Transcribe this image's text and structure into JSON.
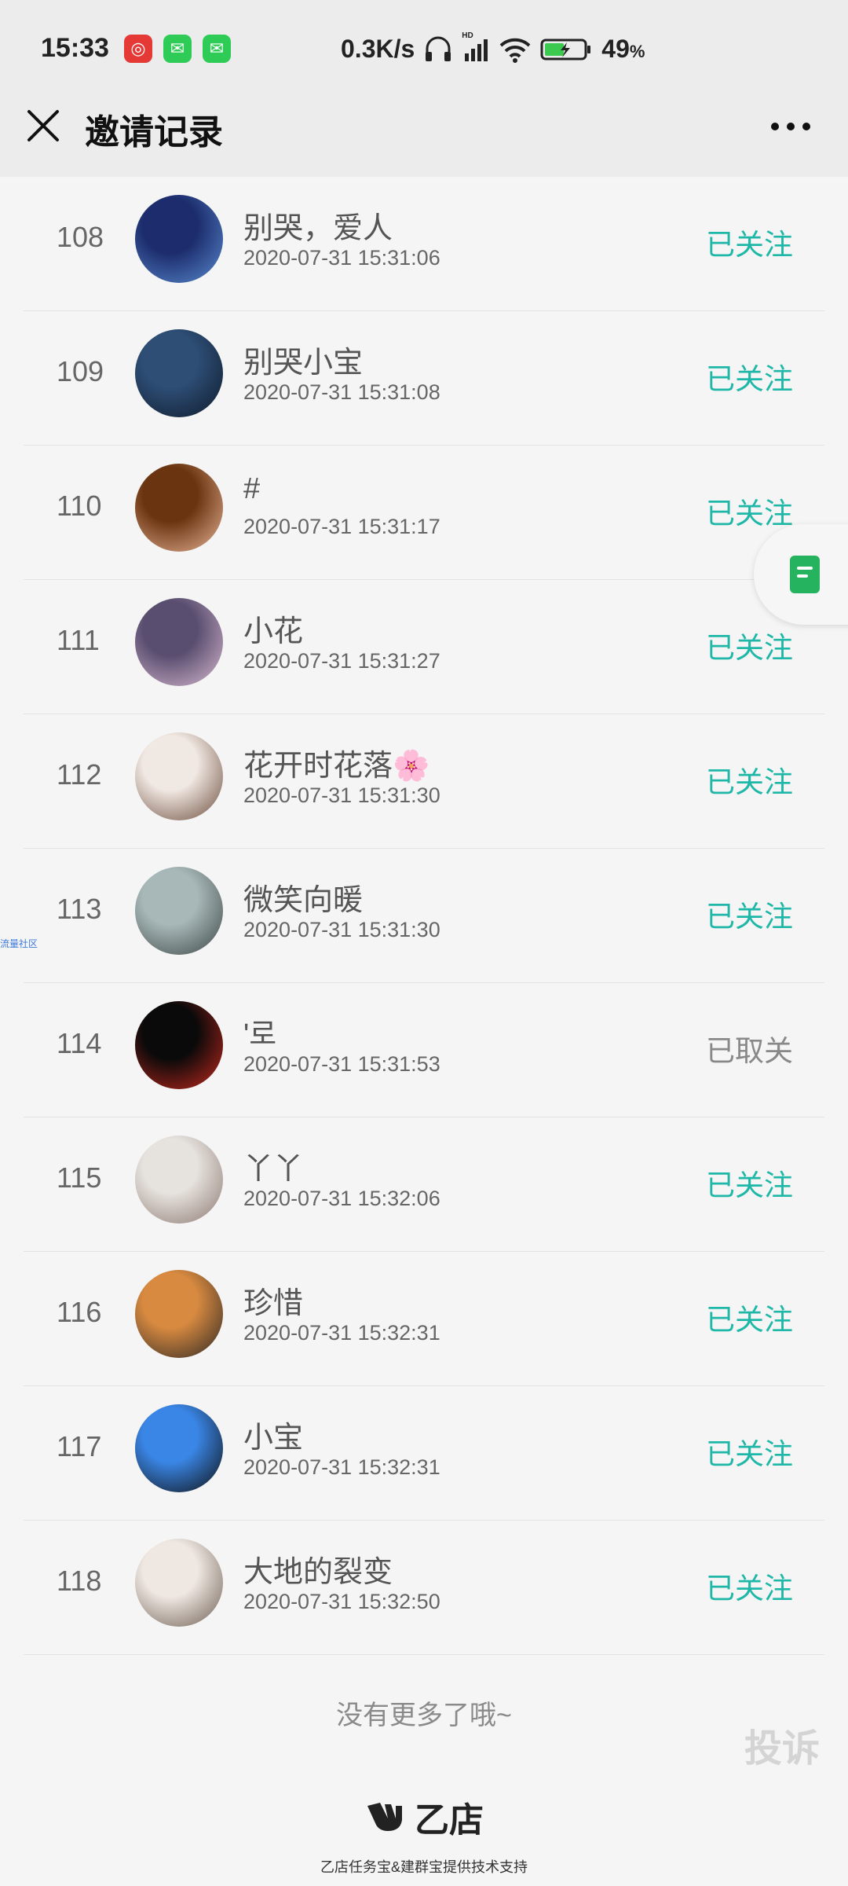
{
  "status_bar": {
    "time": "15:33",
    "network_speed": "0.3K/s",
    "battery": "49",
    "battery_unit": "%",
    "hd_label": "HD"
  },
  "nav": {
    "title": "邀请记录"
  },
  "rows": [
    {
      "index": "108",
      "name": "别哭，爱人",
      "time": "2020-07-31 15:31:06",
      "status": "已关注",
      "status_kind": "followed",
      "avatar_colors": [
        "#1c2c6c",
        "#5a8cd0"
      ]
    },
    {
      "index": "109",
      "name": "别哭小宝",
      "time": "2020-07-31 15:31:08",
      "status": "已关注",
      "status_kind": "followed",
      "avatar_colors": [
        "#2e4e76",
        "#0e1a2a"
      ]
    },
    {
      "index": "110",
      "name": "#",
      "time": "2020-07-31 15:31:17",
      "status": "已关注",
      "status_kind": "followed",
      "avatar_colors": [
        "#6b3410",
        "#e9b79a"
      ]
    },
    {
      "index": "111",
      "name": "小花",
      "time": "2020-07-31 15:31:27",
      "status": "已关注",
      "status_kind": "followed",
      "avatar_colors": [
        "#5a4e70",
        "#d9bad0"
      ]
    },
    {
      "index": "112",
      "name": "花开时花落🌸",
      "time": "2020-07-31 15:31:30",
      "status": "已关注",
      "status_kind": "followed",
      "avatar_colors": [
        "#f0e8e2",
        "#6b4a3a"
      ]
    },
    {
      "index": "113",
      "name": "微笑向暖",
      "time": "2020-07-31 15:31:30",
      "status": "已关注",
      "status_kind": "followed",
      "avatar_colors": [
        "#a8b8b8",
        "#3c4646"
      ]
    },
    {
      "index": "114",
      "name": "'로",
      "time": "2020-07-31 15:31:53",
      "status": "已取关",
      "status_kind": "unfollowed",
      "avatar_colors": [
        "#0a0a0a",
        "#c8281e"
      ]
    },
    {
      "index": "115",
      "name": "丫丫",
      "time": "2020-07-31 15:32:06",
      "status": "已关注",
      "status_kind": "followed",
      "avatar_colors": [
        "#e6e2de",
        "#8c7870"
      ]
    },
    {
      "index": "116",
      "name": "珍惜",
      "time": "2020-07-31 15:32:31",
      "status": "已关注",
      "status_kind": "followed",
      "avatar_colors": [
        "#d88a40",
        "#2a2624"
      ]
    },
    {
      "index": "117",
      "name": "小宝",
      "time": "2020-07-31 15:32:31",
      "status": "已关注",
      "status_kind": "followed",
      "avatar_colors": [
        "#3a86e6",
        "#0e0e0e"
      ]
    },
    {
      "index": "118",
      "name": "大地的裂变",
      "time": "2020-07-31 15:32:50",
      "status": "已关注",
      "status_kind": "followed",
      "avatar_colors": [
        "#efe8e2",
        "#6c5c50"
      ]
    }
  ],
  "footer": {
    "no_more": "没有更多了哦~",
    "complain": "投诉",
    "brand_name": "乙店",
    "brand_sub": "乙店任务宝&建群宝提供技术支持"
  },
  "side_watermark": "流量社区",
  "colors": {
    "accent": "#1fb7a7",
    "muted": "#888888",
    "doc_green": "#25b35f"
  }
}
